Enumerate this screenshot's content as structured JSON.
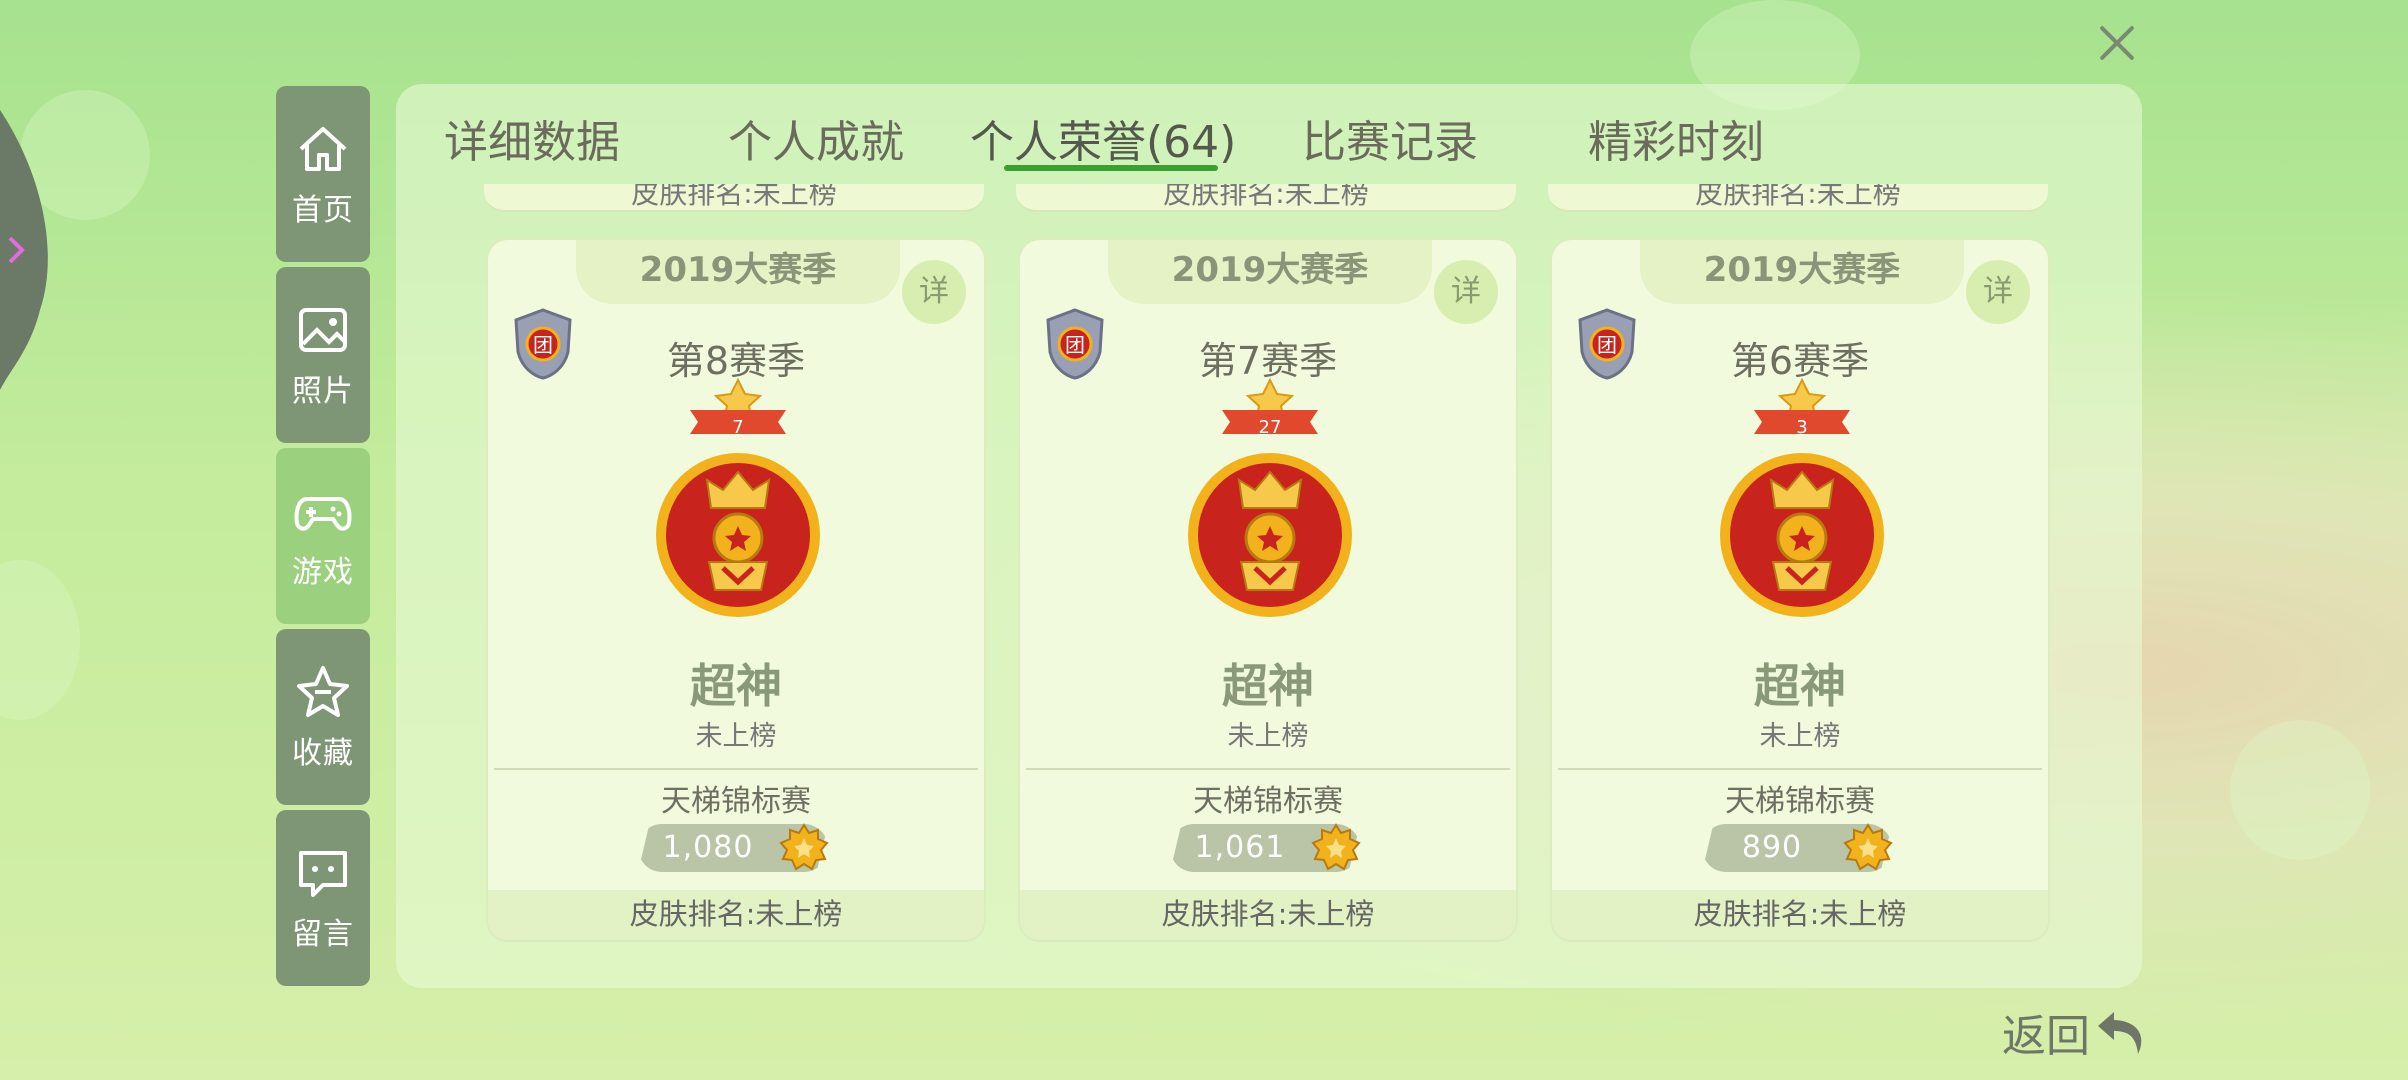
{
  "sidebar": {
    "items": [
      {
        "label": "首页",
        "icon": "home-icon"
      },
      {
        "label": "照片",
        "icon": "photo-icon"
      },
      {
        "label": "游戏",
        "icon": "gamepad-icon",
        "active": true
      },
      {
        "label": "收藏",
        "icon": "star-icon"
      },
      {
        "label": "留言",
        "icon": "message-icon"
      }
    ]
  },
  "tabs": [
    {
      "label": "详细数据"
    },
    {
      "label": "个人成就"
    },
    {
      "label": "个人荣誉(64)",
      "active": true
    },
    {
      "label": "比赛记录"
    },
    {
      "label": "精彩时刻"
    }
  ],
  "peek_cards": [
    {
      "text": "皮肤排名:未上榜"
    },
    {
      "text": "皮肤排名:未上榜"
    },
    {
      "text": "皮肤排名:未上榜"
    }
  ],
  "cards": [
    {
      "season_year": "2019大赛季",
      "detail": "详",
      "team_badge": "团",
      "season": "第8赛季",
      "star_count": "7",
      "rank": "超神",
      "rank_status": "未上榜",
      "mode": "天梯锦标赛",
      "score": "1,080",
      "skin_rank": "皮肤排名:未上榜"
    },
    {
      "season_year": "2019大赛季",
      "detail": "详",
      "team_badge": "团",
      "season": "第7赛季",
      "star_count": "27",
      "rank": "超神",
      "rank_status": "未上榜",
      "mode": "天梯锦标赛",
      "score": "1,061",
      "skin_rank": "皮肤排名:未上榜"
    },
    {
      "season_year": "2019大赛季",
      "detail": "详",
      "team_badge": "团",
      "season": "第6赛季",
      "star_count": "3",
      "rank": "超神",
      "rank_status": "未上榜",
      "mode": "天梯锦标赛",
      "score": "890",
      "skin_rank": "皮肤排名:未上榜"
    }
  ],
  "back": {
    "label": "返回"
  },
  "colors": {
    "accent_green": "#3aa12e",
    "sidebar_active": "#9bd17e",
    "sidebar_inactive": "#7e9676",
    "medal_red": "#c8231c",
    "medal_gold": "#f2b21c"
  }
}
